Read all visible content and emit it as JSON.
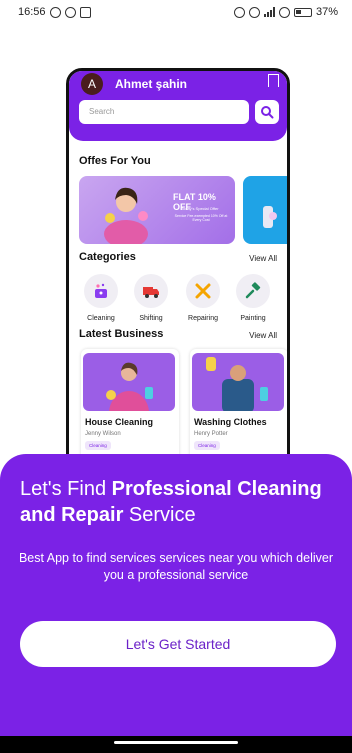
{
  "status_bar": {
    "time": "16:56",
    "battery": "37%"
  },
  "app": {
    "user_initial": "A",
    "user_name": "Ahmet şahin",
    "search_placeholder": "Search",
    "offers_title": "Offes For You",
    "offer": {
      "headline": "FLAT 10% OFF",
      "subtitle": "Today's Special Offer",
      "description": "Service Fee-exempted 10% Off at Every Cost"
    },
    "categories_title": "Categories",
    "categories_view_all": "View All",
    "categories": [
      {
        "label": "Cleaning",
        "icon": "sparkle-bucket-icon",
        "color": "#8a3df0"
      },
      {
        "label": "Shifting",
        "icon": "truck-icon",
        "color": "#e53935"
      },
      {
        "label": "Repairing",
        "icon": "wrench-screwdriver-icon",
        "color": "#f5a500"
      },
      {
        "label": "Painting",
        "icon": "paint-roller-icon",
        "color": "#1f8a5b"
      }
    ],
    "latest_title": "Latest Business",
    "latest_view_all": "View All",
    "businesses": [
      {
        "title": "House Cleaning",
        "owner": "Jenny Wilson",
        "tag": "Cleaning"
      },
      {
        "title": "Washing Clothes",
        "owner": "Henry Potter",
        "tag": "Cleaning"
      }
    ]
  },
  "panel": {
    "title_part1": "Let's Find ",
    "title_bold1": "Professional Cleaning and Repair",
    "title_part2": " Service",
    "description": "Best App to find services services near you which deliver you a professional service",
    "cta_label": "Let's Get Started"
  },
  "colors": {
    "brand": "#7b22e6",
    "cta_text": "#6b21c8"
  }
}
